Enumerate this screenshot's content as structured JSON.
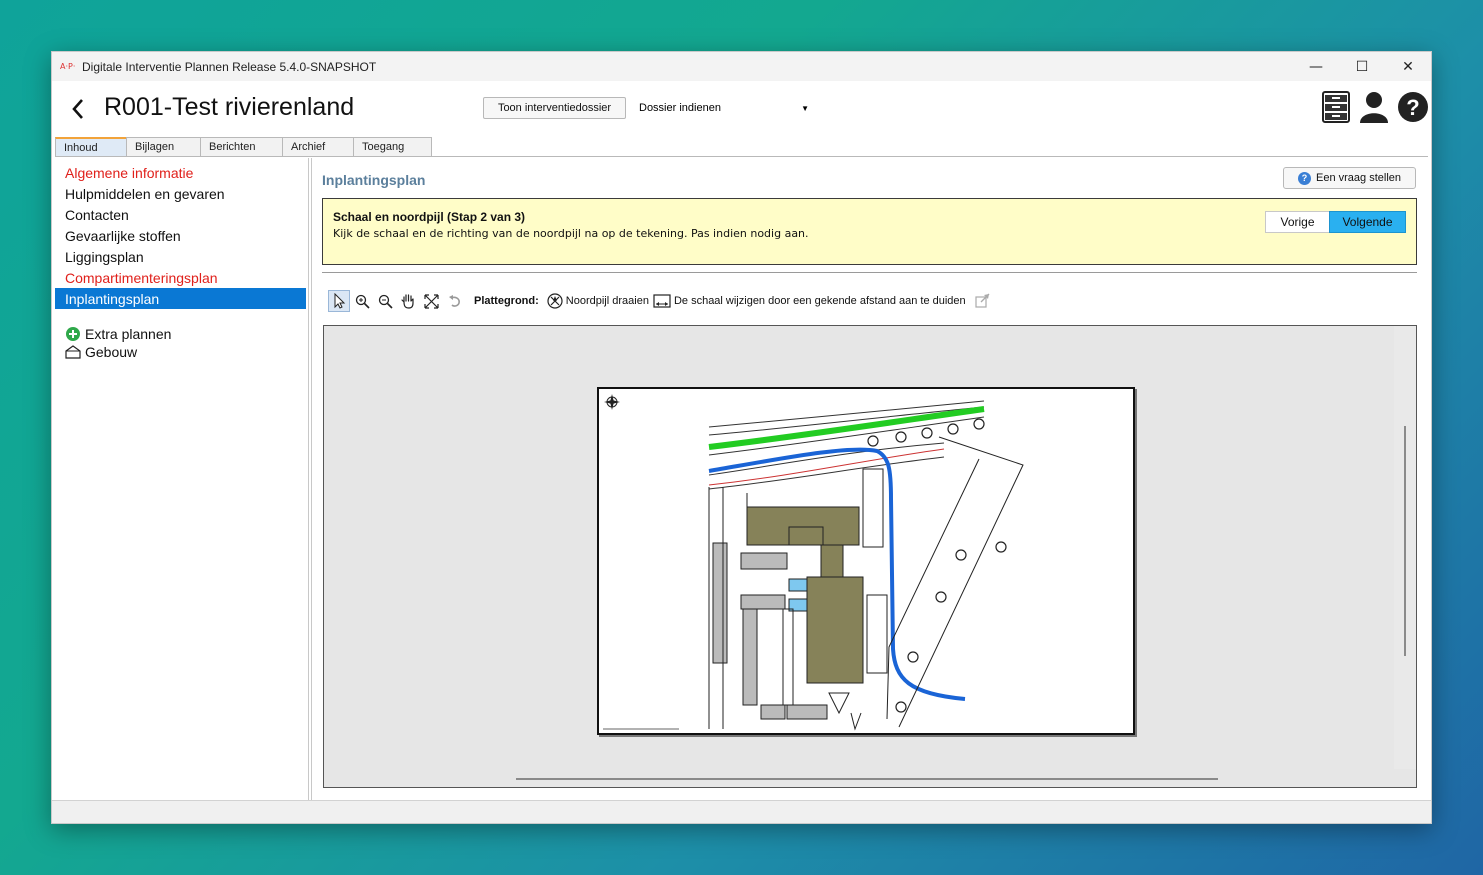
{
  "window": {
    "title": "Digitale Interventie Plannen Release 5.4.0-SNAPSHOT",
    "logo_text": "A·P·",
    "controls": {
      "minimize": "—",
      "maximize": "☐",
      "close": "✕"
    }
  },
  "header": {
    "title": "R001-Test rivierenland",
    "toon_button": "Toon interventiedossier",
    "dossier_select": "Dossier indienen"
  },
  "tabs": [
    "Inhoud",
    "Bijlagen",
    "Berichten",
    "Archief",
    "Toegang"
  ],
  "sidebar": {
    "items": [
      {
        "label": "Algemene informatie"
      },
      {
        "label": "Hulpmiddelen en gevaren"
      },
      {
        "label": "Contacten"
      },
      {
        "label": "Gevaarlijke stoffen"
      },
      {
        "label": "Liggingsplan"
      },
      {
        "label": "Compartimenteringsplan"
      },
      {
        "label": "Inplantingsplan"
      }
    ],
    "extra": [
      {
        "label": "Extra plannen",
        "icon": "plus-circle-icon"
      },
      {
        "label": "Gebouw",
        "icon": "building-icon"
      }
    ]
  },
  "content": {
    "title": "Inplantingsplan",
    "vraag_button": "Een vraag stellen",
    "wizard": {
      "title": "Schaal en noordpijl (Stap 2 van 3)",
      "text": "Kijk de schaal en de richting van de noordpijl na op de tekening. Pas indien nodig aan.",
      "prev": "Vorige",
      "next": "Volgende"
    },
    "toolbar": {
      "label": "Plattegrond:",
      "rotate": "Noordpijl draaien",
      "scale": "De schaal wijzigen door een gekende afstand aan te duiden"
    }
  },
  "colors": {
    "accent": "#0a78d4",
    "warning_bg": "#fffdc8",
    "next_button": "#2ab0f0",
    "building": "#868259",
    "road_green": "#22cc22",
    "road_blue": "#1a64d6"
  }
}
